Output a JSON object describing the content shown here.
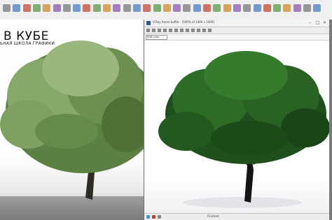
{
  "left_viewport": {
    "title": "В КУБЕ",
    "subtitle": "ЬНАЯ ШКОЛА ГРАФИКИ"
  },
  "render_window": {
    "title": "V-Ray frame buffer - [100% of 1400 x 1000]",
    "channel": "RGB color",
    "status": "Finished"
  },
  "toolbar": {
    "icons": [
      "undo-icon",
      "redo-icon",
      "link-icon",
      "unlink-icon",
      "bind-icon",
      "select-icon",
      "filter-icon",
      "select-name-icon",
      "rect-select-icon",
      "window-crossing-icon",
      "move-icon",
      "rotate-icon",
      "scale-icon",
      "refcoord-icon",
      "pivot-icon",
      "select-manip-icon",
      "snap-icon",
      "angle-snap-icon",
      "percent-snap-icon",
      "spinner-snap-icon",
      "named-sets-icon",
      "mirror-icon",
      "align-icon",
      "layers-icon",
      "curve-editor-icon",
      "schematic-icon",
      "material-editor-icon",
      "render-setup-icon",
      "rendered-frame-icon",
      "render-icon",
      "vray-icon",
      "vray-frame-icon"
    ]
  }
}
